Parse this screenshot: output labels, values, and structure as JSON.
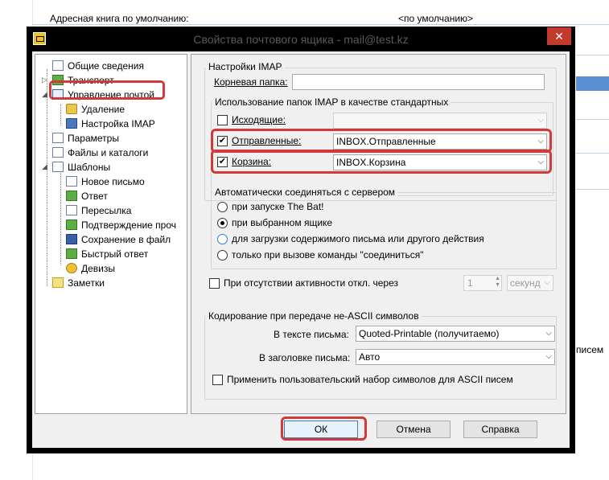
{
  "background": {
    "label": "Адресная книга по умолчанию:",
    "value": "<по умолчанию>",
    "side_text": "писем"
  },
  "dialog": {
    "title": "Свойства почтового ящика - mail@test.kz",
    "close_glyph": "✕"
  },
  "tree": {
    "items": [
      {
        "label": "Общие сведения"
      },
      {
        "label": "Транспорт"
      },
      {
        "label": "Управление почтой"
      },
      {
        "label": "Удаление"
      },
      {
        "label": "Настройка IMAP"
      },
      {
        "label": "Параметры"
      },
      {
        "label": "Файлы и каталоги"
      },
      {
        "label": "Шаблоны"
      },
      {
        "label": "Новое письмо"
      },
      {
        "label": "Ответ"
      },
      {
        "label": "Пересылка"
      },
      {
        "label": "Подтверждение проч"
      },
      {
        "label": "Сохранение в файл"
      },
      {
        "label": "Быстрый ответ"
      },
      {
        "label": "Девизы"
      },
      {
        "label": "Заметки"
      }
    ]
  },
  "imap": {
    "group_title": "Настройки IMAP",
    "root_folder_label": "Корневая папка:",
    "root_folder_value": "",
    "folders_group_title": "Использование папок IMAP в качестве стандартных",
    "outgoing_label": "Исходящие:",
    "outgoing_value": "",
    "outgoing_checked": false,
    "sent_label": "Отправленные:",
    "sent_value": "INBOX.Отправленные",
    "sent_checked": true,
    "trash_label": "Корзина:",
    "trash_value": "INBOX.Корзина",
    "trash_checked": true
  },
  "autoconnect": {
    "group_title": "Автоматически соединяться с сервером",
    "options": [
      {
        "label": "при запуске The Bat!",
        "selected": false
      },
      {
        "label": "при выбранном ящике",
        "selected": true
      },
      {
        "label": "для загрузки содержимого письма или другого действия",
        "selected": false
      },
      {
        "label": "только при вызове команды \"соединиться\"",
        "selected": false
      }
    ]
  },
  "inactivity": {
    "label": "При отсутствии активности откл. через",
    "checked": false,
    "value": "1",
    "unit": "секунд"
  },
  "encoding": {
    "group_title": "Кодирование при передаче не-ASCII символов",
    "body_label": "В тексте письма:",
    "body_value": "Quoted-Printable (получитаемо)",
    "header_label": "В заголовке письма:",
    "header_value": "Авто",
    "custom_charset_label": "Применить пользовательский набор символов для ASCII писем",
    "custom_charset_checked": false
  },
  "buttons": {
    "ok": "ОК",
    "cancel": "Отмена",
    "help": "Справка"
  },
  "colors": {
    "highlight": "#d03a3a",
    "titlebar": "#000000",
    "close": "#c23a2b"
  }
}
